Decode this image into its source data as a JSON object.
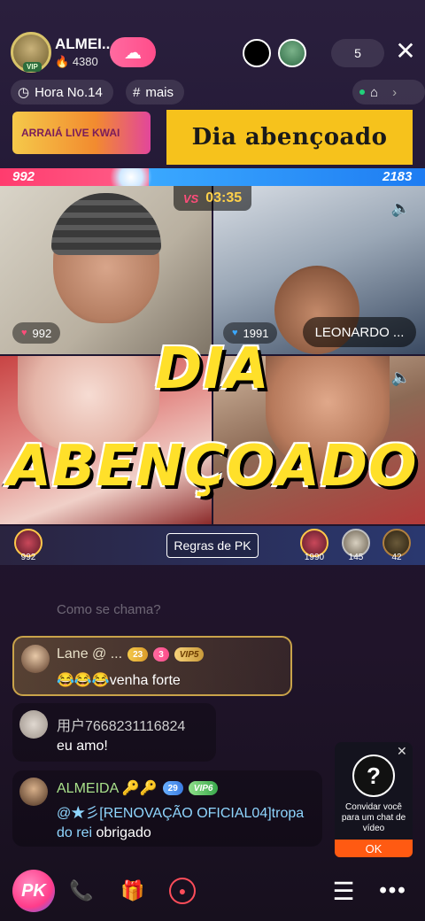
{
  "host": {
    "name": "ALMEI...",
    "coins": "4380",
    "vip": "VIP"
  },
  "top": {
    "viewer_count": "5"
  },
  "chips": {
    "hour": "Hora No.14",
    "more": "mais"
  },
  "banners": {
    "left": "ARRAIÁ LIVE KWAI",
    "right": "Dia abençoado"
  },
  "pk": {
    "score_left": "992",
    "score_right": "2183",
    "vs": "VS",
    "timer": "03:35",
    "tile1_score": "992",
    "tile2_score": "1991",
    "tile2_name": "LEONARDO ...",
    "rules_label": "Regras de PK",
    "contrib_left": "992",
    "contrib_right": [
      "1990",
      "145",
      "42"
    ]
  },
  "overlay": {
    "line1": "DIA",
    "line2": "ABENÇOADO"
  },
  "chat": {
    "faded": "Como se chama?",
    "messages": [
      {
        "user": "Lane @ ...",
        "level": "23",
        "heart": "3",
        "vip": "VIP5",
        "text": "😂😂😂venha forte"
      },
      {
        "user": "用户7668231116824",
        "text": "eu amo!"
      },
      {
        "user": "ALMEIDA 🔑🔑",
        "level": "29",
        "vip": "VIP6",
        "mention": "@★彡[RENOVAÇÃO OFICIAL04]tropa do rei",
        "text": " obrigado"
      }
    ]
  },
  "invite": {
    "text": "Convidar você para um chat de vídeo",
    "ok": "OK"
  },
  "bottom": {
    "pk": "PK"
  },
  "colors": {
    "accent_pink": "#ff4d8a",
    "accent_blue": "#1e7cf2",
    "overlay_yellow": "#ffe02a",
    "invite_ok": "#ff5a12"
  }
}
